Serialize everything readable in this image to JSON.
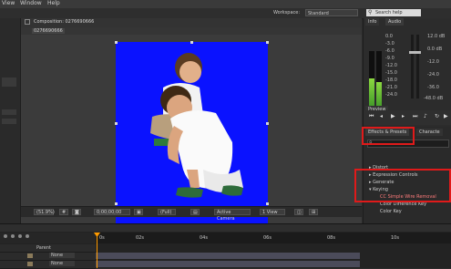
{
  "menu": {
    "items": [
      "View",
      "Window",
      "Help"
    ]
  },
  "workspace": {
    "label": "Workspace:",
    "value": "Standard",
    "search_placeholder": "Search help"
  },
  "composition": {
    "tab_label": "Composition: 0276690666",
    "sub_label": "0276690666"
  },
  "viewer": {
    "zoom": "(51.9%)",
    "timecode": "0;00;00;00",
    "resolution": "(Full)",
    "camera": "Active Camera",
    "views": "1 View"
  },
  "info": {
    "tabs": [
      "Info",
      "Audio"
    ],
    "db_left": [
      "0.0",
      "-3.0",
      "-6.0",
      "-9.0",
      "-12.0",
      "-15.0",
      "-18.0",
      "-21.0",
      "-24.0"
    ],
    "db_right": [
      "12.0 dB",
      "0.0 dB",
      "-12.0",
      "-24.0",
      "-36.0",
      "-48.0 dB"
    ]
  },
  "preview": {
    "tab_label": "Preview"
  },
  "effects": {
    "tab_label": "Effects & Presets",
    "other_tab": "Characte",
    "search_value": "",
    "items": [
      {
        "label": "Distort",
        "child": false
      },
      {
        "label": "Expression Controls",
        "child": false
      },
      {
        "label": "Generate",
        "child": false
      },
      {
        "label": "Keying",
        "child": false
      },
      {
        "label": "CC Simple Wire Removal",
        "child": true
      },
      {
        "label": "Color Difference Key",
        "child": true
      },
      {
        "label": "Color Key",
        "child": true
      }
    ]
  },
  "timeline": {
    "layers": [
      {
        "name": "Parent",
        "mode": ""
      },
      {
        "name": "None",
        "mode": ""
      },
      {
        "name": "None",
        "mode": ""
      }
    ],
    "ruler_ticks": [
      "0s",
      "02s",
      "04s",
      "06s",
      "08s",
      "10s"
    ]
  },
  "colors": {
    "canvas_blue": "#0a12ff",
    "highlight_red": "#e01a1a",
    "playhead": "#ff9b00"
  }
}
